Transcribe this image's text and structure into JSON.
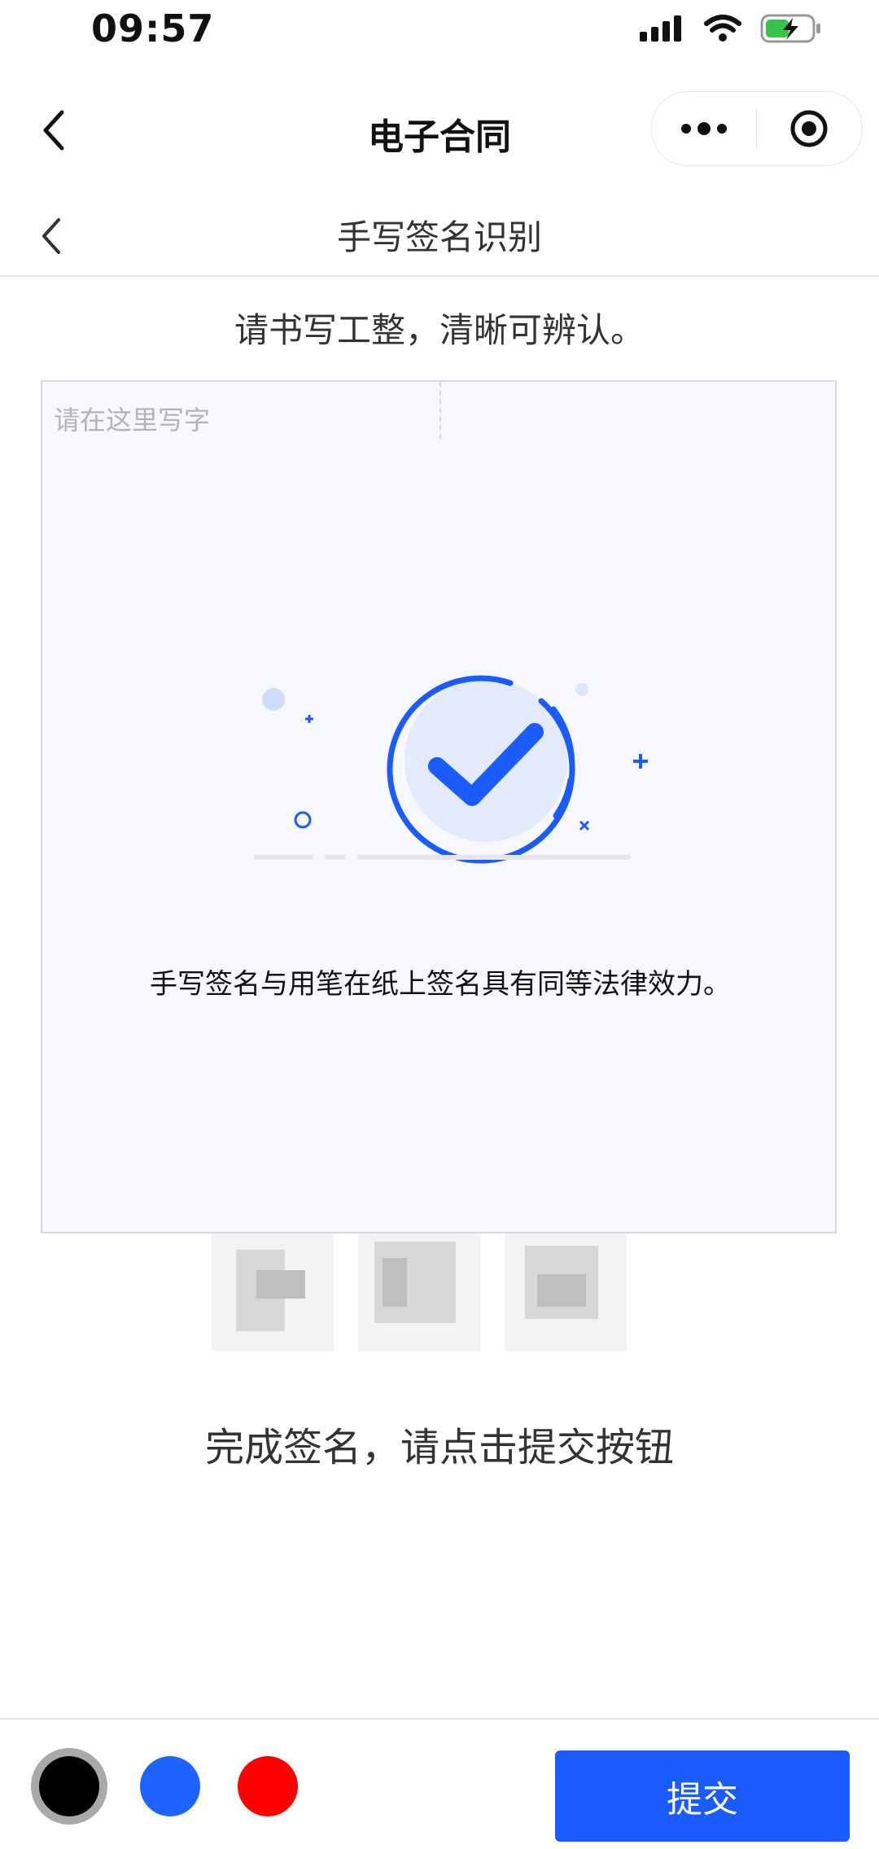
{
  "status": {
    "time": "09:57"
  },
  "nav": {
    "title": "电子合同"
  },
  "subnav": {
    "title": "手写签名识别"
  },
  "instruction": "请书写工整，清晰可辨认。",
  "canvas": {
    "placeholder": "请在这里写字",
    "legal_notice": "手写签名与用笔在纸上签名具有同等法律效力。"
  },
  "hint": "完成签名，请点击提交按钮",
  "colors": [
    "#000000",
    "#1d63ff",
    "#ff0000"
  ],
  "selected_color": "#000000",
  "submit_label": "提交",
  "accent": "#1a5cff"
}
